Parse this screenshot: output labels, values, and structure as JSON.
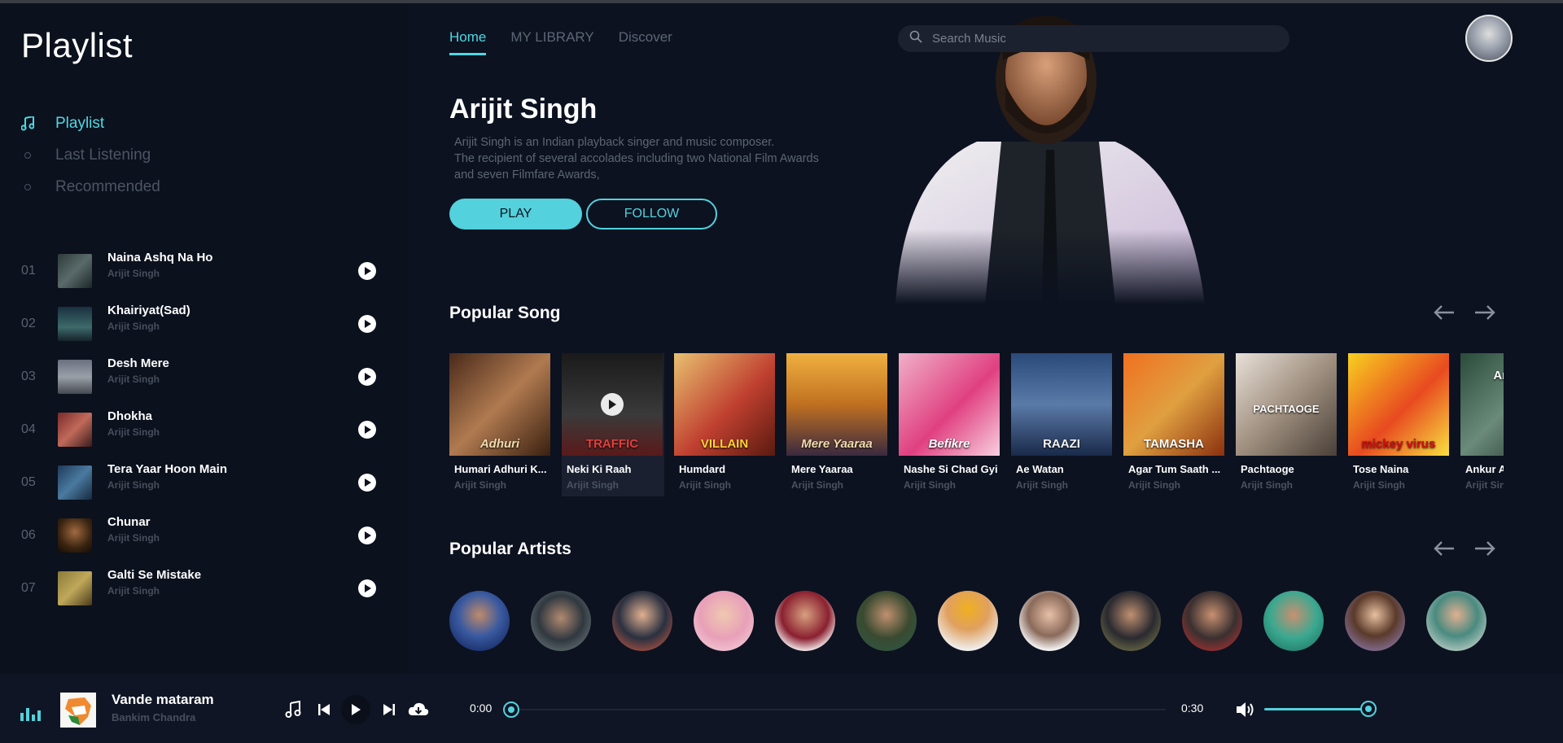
{
  "app": {
    "brand": "Playlist"
  },
  "colors": {
    "accent": "#4ed8e3",
    "background": "#0c1220",
    "sidebar": "#0b111d",
    "player": "#0f1524"
  },
  "sidebar": {
    "nav": [
      {
        "label": "Playlist",
        "icon": "music-note-icon",
        "active": true
      },
      {
        "label": "Last Listening",
        "icon": "circle-icon",
        "active": false
      },
      {
        "label": "Recommended",
        "icon": "circle-icon",
        "active": false
      }
    ],
    "tracks": [
      {
        "num": "01",
        "title": "Naina Ashq Na Ho",
        "artist": "Arijit Singh"
      },
      {
        "num": "02",
        "title": "Khairiyat(Sad)",
        "artist": "Arijit Singh"
      },
      {
        "num": "03",
        "title": "Desh Mere",
        "artist": "Arijit Singh"
      },
      {
        "num": "04",
        "title": "Dhokha",
        "artist": "Arijit Singh"
      },
      {
        "num": "05",
        "title": "Tera Yaar Hoon Main",
        "artist": "Arijit Singh"
      },
      {
        "num": "06",
        "title": "Chunar",
        "artist": "Arijit Singh"
      },
      {
        "num": "07",
        "title": "Galti Se Mistake",
        "artist": "Arijit Singh"
      }
    ]
  },
  "header": {
    "tabs": [
      {
        "label": "Home",
        "active": true
      },
      {
        "label": "MY LIBRARY",
        "active": false
      },
      {
        "label": "Discover",
        "active": false
      }
    ],
    "search": {
      "placeholder": "Search Music"
    }
  },
  "hero": {
    "name": "Arijit Singh",
    "desc1": "Arijit Singh is an Indian playback singer and music composer.",
    "desc2": "The recipient of several accolades including two National Film Awards",
    "desc3": "and seven Filmfare Awards,",
    "play_label": "PLAY",
    "follow_label": "FOLLOW"
  },
  "popular_songs": {
    "title": "Popular Song",
    "items": [
      {
        "title": "Humari Adhuri K...",
        "artist": "Arijit Singh",
        "cover_text": "Adhuri"
      },
      {
        "title": "Neki Ki Raah",
        "artist": "Arijit Singh",
        "cover_text": "TRAFFIC"
      },
      {
        "title": "Humdard",
        "artist": "Arijit Singh",
        "cover_text": "VILLAIN"
      },
      {
        "title": "Mere Yaaraa",
        "artist": "Arijit Singh",
        "cover_text": "Mere Yaaraa"
      },
      {
        "title": "Nashe Si Chad Gyi",
        "artist": "Arijit Singh",
        "cover_text": "Befikre"
      },
      {
        "title": "Ae Watan",
        "artist": "Arijit Singh",
        "cover_text": "RAAZI"
      },
      {
        "title": "Agar Tum Saath ...",
        "artist": "Arijit Singh",
        "cover_text": "TAMASHA"
      },
      {
        "title": "Pachtaoge",
        "artist": "Arijit Singh",
        "cover_text": "PACHTAOGE"
      },
      {
        "title": "Tose Naina",
        "artist": "Arijit Singh",
        "cover_text": "mickey virus"
      },
      {
        "title": "Ankur Ankur",
        "artist": "Arijit Singh",
        "cover_text": "Ankur"
      }
    ]
  },
  "popular_artists": {
    "title": "Popular Artists",
    "count": 13
  },
  "player": {
    "title": "Vande mataram",
    "artist": "Bankim Chandra",
    "current_time": "0:00",
    "duration": "0:30",
    "progress": 0,
    "volume": 0.92
  }
}
